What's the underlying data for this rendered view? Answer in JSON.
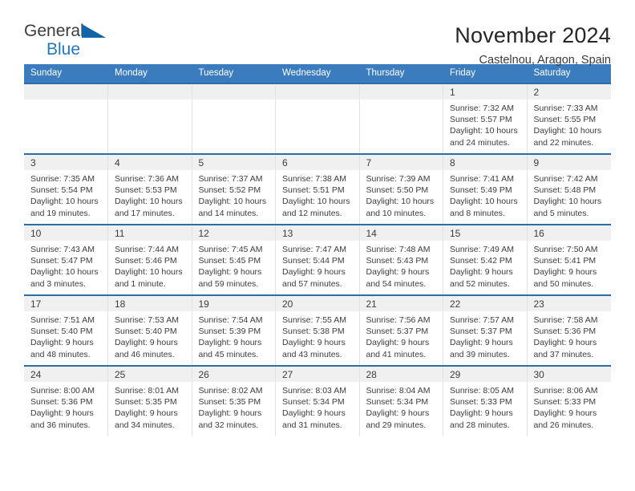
{
  "brand": {
    "name_part1": "General",
    "name_part2": "Blue"
  },
  "header": {
    "title": "November 2024",
    "location": "Castelnou, Aragon, Spain"
  },
  "colors": {
    "header_blue": "#3b7cbf",
    "row_border_blue": "#2c6da8",
    "daynum_band": "#f0f0f0",
    "brand_blue": "#1f7ac4"
  },
  "weekdays": [
    "Sunday",
    "Monday",
    "Tuesday",
    "Wednesday",
    "Thursday",
    "Friday",
    "Saturday"
  ],
  "weeks": [
    [
      {
        "day": "",
        "sunrise": "",
        "sunset": "",
        "daylight1": "",
        "daylight2": "",
        "empty": true
      },
      {
        "day": "",
        "sunrise": "",
        "sunset": "",
        "daylight1": "",
        "daylight2": "",
        "empty": true
      },
      {
        "day": "",
        "sunrise": "",
        "sunset": "",
        "daylight1": "",
        "daylight2": "",
        "empty": true
      },
      {
        "day": "",
        "sunrise": "",
        "sunset": "",
        "daylight1": "",
        "daylight2": "",
        "empty": true
      },
      {
        "day": "",
        "sunrise": "",
        "sunset": "",
        "daylight1": "",
        "daylight2": "",
        "empty": true
      },
      {
        "day": "1",
        "sunrise": "Sunrise: 7:32 AM",
        "sunset": "Sunset: 5:57 PM",
        "daylight1": "Daylight: 10 hours",
        "daylight2": "and 24 minutes.",
        "empty": false
      },
      {
        "day": "2",
        "sunrise": "Sunrise: 7:33 AM",
        "sunset": "Sunset: 5:55 PM",
        "daylight1": "Daylight: 10 hours",
        "daylight2": "and 22 minutes.",
        "empty": false
      }
    ],
    [
      {
        "day": "3",
        "sunrise": "Sunrise: 7:35 AM",
        "sunset": "Sunset: 5:54 PM",
        "daylight1": "Daylight: 10 hours",
        "daylight2": "and 19 minutes.",
        "empty": false
      },
      {
        "day": "4",
        "sunrise": "Sunrise: 7:36 AM",
        "sunset": "Sunset: 5:53 PM",
        "daylight1": "Daylight: 10 hours",
        "daylight2": "and 17 minutes.",
        "empty": false
      },
      {
        "day": "5",
        "sunrise": "Sunrise: 7:37 AM",
        "sunset": "Sunset: 5:52 PM",
        "daylight1": "Daylight: 10 hours",
        "daylight2": "and 14 minutes.",
        "empty": false
      },
      {
        "day": "6",
        "sunrise": "Sunrise: 7:38 AM",
        "sunset": "Sunset: 5:51 PM",
        "daylight1": "Daylight: 10 hours",
        "daylight2": "and 12 minutes.",
        "empty": false
      },
      {
        "day": "7",
        "sunrise": "Sunrise: 7:39 AM",
        "sunset": "Sunset: 5:50 PM",
        "daylight1": "Daylight: 10 hours",
        "daylight2": "and 10 minutes.",
        "empty": false
      },
      {
        "day": "8",
        "sunrise": "Sunrise: 7:41 AM",
        "sunset": "Sunset: 5:49 PM",
        "daylight1": "Daylight: 10 hours",
        "daylight2": "and 8 minutes.",
        "empty": false
      },
      {
        "day": "9",
        "sunrise": "Sunrise: 7:42 AM",
        "sunset": "Sunset: 5:48 PM",
        "daylight1": "Daylight: 10 hours",
        "daylight2": "and 5 minutes.",
        "empty": false
      }
    ],
    [
      {
        "day": "10",
        "sunrise": "Sunrise: 7:43 AM",
        "sunset": "Sunset: 5:47 PM",
        "daylight1": "Daylight: 10 hours",
        "daylight2": "and 3 minutes.",
        "empty": false
      },
      {
        "day": "11",
        "sunrise": "Sunrise: 7:44 AM",
        "sunset": "Sunset: 5:46 PM",
        "daylight1": "Daylight: 10 hours",
        "daylight2": "and 1 minute.",
        "empty": false
      },
      {
        "day": "12",
        "sunrise": "Sunrise: 7:45 AM",
        "sunset": "Sunset: 5:45 PM",
        "daylight1": "Daylight: 9 hours",
        "daylight2": "and 59 minutes.",
        "empty": false
      },
      {
        "day": "13",
        "sunrise": "Sunrise: 7:47 AM",
        "sunset": "Sunset: 5:44 PM",
        "daylight1": "Daylight: 9 hours",
        "daylight2": "and 57 minutes.",
        "empty": false
      },
      {
        "day": "14",
        "sunrise": "Sunrise: 7:48 AM",
        "sunset": "Sunset: 5:43 PM",
        "daylight1": "Daylight: 9 hours",
        "daylight2": "and 54 minutes.",
        "empty": false
      },
      {
        "day": "15",
        "sunrise": "Sunrise: 7:49 AM",
        "sunset": "Sunset: 5:42 PM",
        "daylight1": "Daylight: 9 hours",
        "daylight2": "and 52 minutes.",
        "empty": false
      },
      {
        "day": "16",
        "sunrise": "Sunrise: 7:50 AM",
        "sunset": "Sunset: 5:41 PM",
        "daylight1": "Daylight: 9 hours",
        "daylight2": "and 50 minutes.",
        "empty": false
      }
    ],
    [
      {
        "day": "17",
        "sunrise": "Sunrise: 7:51 AM",
        "sunset": "Sunset: 5:40 PM",
        "daylight1": "Daylight: 9 hours",
        "daylight2": "and 48 minutes.",
        "empty": false
      },
      {
        "day": "18",
        "sunrise": "Sunrise: 7:53 AM",
        "sunset": "Sunset: 5:40 PM",
        "daylight1": "Daylight: 9 hours",
        "daylight2": "and 46 minutes.",
        "empty": false
      },
      {
        "day": "19",
        "sunrise": "Sunrise: 7:54 AM",
        "sunset": "Sunset: 5:39 PM",
        "daylight1": "Daylight: 9 hours",
        "daylight2": "and 45 minutes.",
        "empty": false
      },
      {
        "day": "20",
        "sunrise": "Sunrise: 7:55 AM",
        "sunset": "Sunset: 5:38 PM",
        "daylight1": "Daylight: 9 hours",
        "daylight2": "and 43 minutes.",
        "empty": false
      },
      {
        "day": "21",
        "sunrise": "Sunrise: 7:56 AM",
        "sunset": "Sunset: 5:37 PM",
        "daylight1": "Daylight: 9 hours",
        "daylight2": "and 41 minutes.",
        "empty": false
      },
      {
        "day": "22",
        "sunrise": "Sunrise: 7:57 AM",
        "sunset": "Sunset: 5:37 PM",
        "daylight1": "Daylight: 9 hours",
        "daylight2": "and 39 minutes.",
        "empty": false
      },
      {
        "day": "23",
        "sunrise": "Sunrise: 7:58 AM",
        "sunset": "Sunset: 5:36 PM",
        "daylight1": "Daylight: 9 hours",
        "daylight2": "and 37 minutes.",
        "empty": false
      }
    ],
    [
      {
        "day": "24",
        "sunrise": "Sunrise: 8:00 AM",
        "sunset": "Sunset: 5:36 PM",
        "daylight1": "Daylight: 9 hours",
        "daylight2": "and 36 minutes.",
        "empty": false
      },
      {
        "day": "25",
        "sunrise": "Sunrise: 8:01 AM",
        "sunset": "Sunset: 5:35 PM",
        "daylight1": "Daylight: 9 hours",
        "daylight2": "and 34 minutes.",
        "empty": false
      },
      {
        "day": "26",
        "sunrise": "Sunrise: 8:02 AM",
        "sunset": "Sunset: 5:35 PM",
        "daylight1": "Daylight: 9 hours",
        "daylight2": "and 32 minutes.",
        "empty": false
      },
      {
        "day": "27",
        "sunrise": "Sunrise: 8:03 AM",
        "sunset": "Sunset: 5:34 PM",
        "daylight1": "Daylight: 9 hours",
        "daylight2": "and 31 minutes.",
        "empty": false
      },
      {
        "day": "28",
        "sunrise": "Sunrise: 8:04 AM",
        "sunset": "Sunset: 5:34 PM",
        "daylight1": "Daylight: 9 hours",
        "daylight2": "and 29 minutes.",
        "empty": false
      },
      {
        "day": "29",
        "sunrise": "Sunrise: 8:05 AM",
        "sunset": "Sunset: 5:33 PM",
        "daylight1": "Daylight: 9 hours",
        "daylight2": "and 28 minutes.",
        "empty": false
      },
      {
        "day": "30",
        "sunrise": "Sunrise: 8:06 AM",
        "sunset": "Sunset: 5:33 PM",
        "daylight1": "Daylight: 9 hours",
        "daylight2": "and 26 minutes.",
        "empty": false
      }
    ]
  ]
}
